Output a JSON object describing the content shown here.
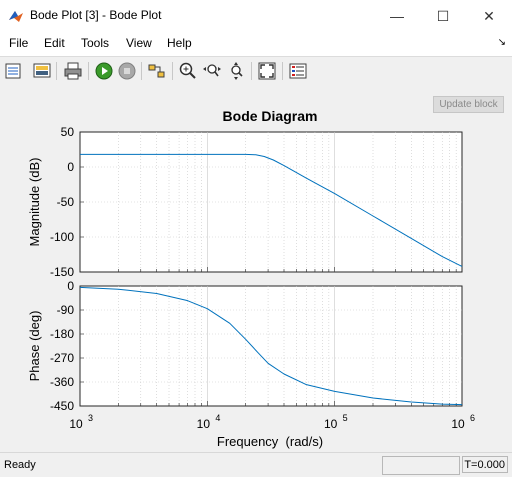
{
  "window": {
    "title": "Bode Plot [3] - Bode Plot",
    "minimize_icon": "minimize-icon",
    "maximize_icon": "maximize-icon",
    "close_icon": "close-icon"
  },
  "menu": [
    "File",
    "Edit",
    "Tools",
    "View",
    "Help"
  ],
  "toolbar": {
    "icons": [
      "properties-icon",
      "axes-properties-icon",
      "print-icon",
      "run-icon",
      "stop-icon",
      "linear-analysis-icon",
      "zoom-in-icon",
      "zoom-x-icon",
      "zoom-y-icon",
      "autoscale-icon",
      "legend-icon"
    ]
  },
  "plot": {
    "update_label": "Update block"
  },
  "chart_data": {
    "type": "line",
    "title": "Bode Diagram",
    "xlabel": "Frequency  (rad/s)",
    "x_scale": "log",
    "x_ticks": [
      "10",
      "10",
      "10",
      "10"
    ],
    "x_tick_exponents": [
      "3",
      "4",
      "5",
      "6"
    ],
    "xlim": [
      1000,
      1000000
    ],
    "panels": [
      {
        "name": "magnitude",
        "ylabel": "Magnitude (dB)",
        "ylim": [
          -150,
          50
        ],
        "y_ticks": [
          "50",
          "0",
          "-50",
          "-100",
          "-150"
        ],
        "x": [
          1000,
          5000,
          10000,
          15000,
          20000,
          24000,
          28000,
          33000,
          40000,
          60000,
          100000,
          200000,
          400000,
          700000,
          1000000
        ],
        "y": [
          18,
          18,
          18,
          18,
          18,
          17.5,
          15,
          10,
          2,
          -16,
          -38,
          -70,
          -102,
          -128,
          -142
        ]
      },
      {
        "name": "phase",
        "ylabel": "Phase (deg)",
        "ylim": [
          -450,
          0
        ],
        "y_ticks": [
          "0",
          "-90",
          "-180",
          "-270",
          "-360",
          "-450"
        ],
        "x": [
          1000,
          2000,
          4000,
          7000,
          10000,
          15000,
          20000,
          25000,
          30000,
          40000,
          60000,
          100000,
          200000,
          400000,
          700000,
          1000000
        ],
        "y": [
          -5,
          -12,
          -28,
          -55,
          -85,
          -140,
          -200,
          -250,
          -290,
          -330,
          -370,
          -395,
          -420,
          -435,
          -443,
          -445
        ]
      }
    ],
    "grid": true,
    "series_color": "#0072bd"
  },
  "status": {
    "text": "Ready",
    "time": "T=0.000"
  }
}
